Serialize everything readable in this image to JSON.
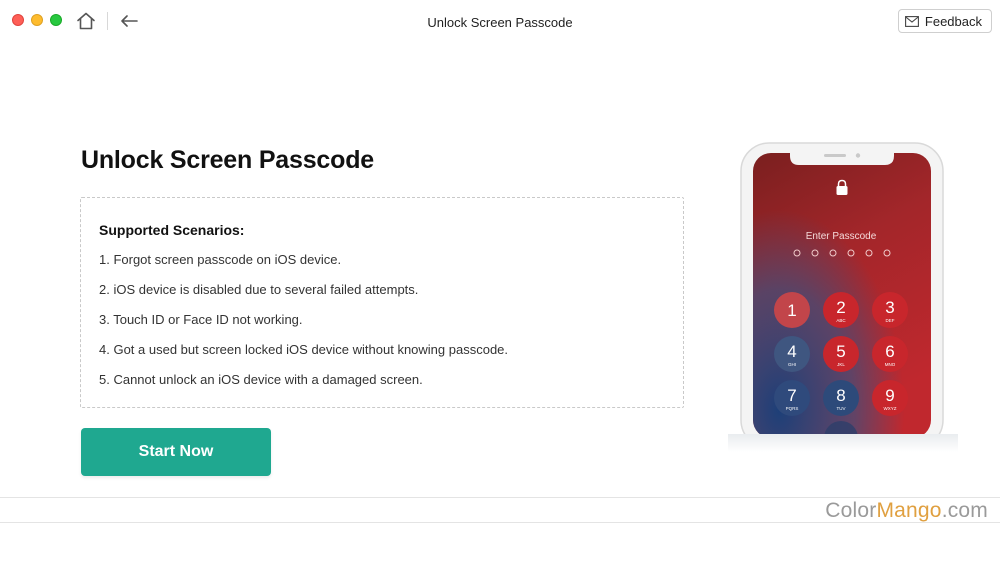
{
  "window": {
    "title": "Unlock Screen Passcode",
    "feedback_label": "Feedback"
  },
  "main": {
    "heading": "Unlock Screen Passcode",
    "scenarios": {
      "title": "Supported Scenarios:",
      "items": [
        "1. Forgot screen passcode on iOS device.",
        "2. iOS device is disabled due to several failed attempts.",
        "3. Touch ID or Face ID not working.",
        "4. Got a used but screen locked iOS device without knowing passcode.",
        "5. Cannot unlock an iOS device with a damaged screen."
      ]
    },
    "start_button": "Start Now"
  },
  "phone": {
    "prompt": "Enter Passcode",
    "keys": [
      {
        "digit": "1",
        "letters": ""
      },
      {
        "digit": "2",
        "letters": "ABC"
      },
      {
        "digit": "3",
        "letters": "DEF"
      },
      {
        "digit": "4",
        "letters": "GHI"
      },
      {
        "digit": "5",
        "letters": "JKL"
      },
      {
        "digit": "6",
        "letters": "MNO"
      },
      {
        "digit": "7",
        "letters": "PQRS"
      },
      {
        "digit": "8",
        "letters": "TUV"
      },
      {
        "digit": "9",
        "letters": "WXYZ"
      }
    ]
  },
  "watermark": {
    "part1": "Color",
    "part2": "Mango",
    "part3": ".com"
  },
  "colors": {
    "accent": "#1fa890",
    "watermark_accent": "#e0a040"
  }
}
